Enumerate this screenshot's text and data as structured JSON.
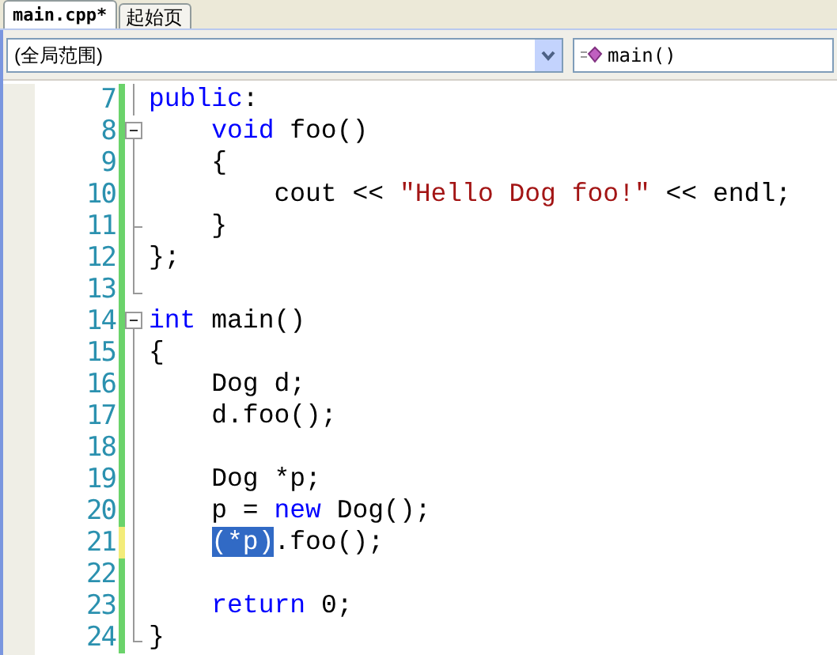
{
  "tabs": [
    {
      "label": "main.cpp*",
      "selected": true
    },
    {
      "label": "起始页",
      "selected": false
    }
  ],
  "scope_dropdown": {
    "value": "(全局范围)"
  },
  "member_dropdown": {
    "value": "main()"
  },
  "lines": [
    {
      "number": "7",
      "modified": false,
      "kind": "line",
      "tokens": [
        {
          "kind": "keyword",
          "text": "public"
        },
        {
          "kind": "plain",
          "text": ":"
        }
      ]
    },
    {
      "number": "8",
      "modified": false,
      "kind": "box",
      "tokens": [
        {
          "kind": "keyword",
          "text": "    void"
        },
        {
          "kind": "plain",
          "text": " foo()"
        }
      ]
    },
    {
      "number": "9",
      "modified": false,
      "kind": "line",
      "tokens": [
        {
          "kind": "plain",
          "text": "    {"
        }
      ]
    },
    {
      "number": "10",
      "modified": false,
      "kind": "line",
      "tokens": [
        {
          "kind": "plain",
          "text": "        cout << "
        },
        {
          "kind": "string",
          "text": "\"Hello Dog foo!\""
        },
        {
          "kind": "plain",
          "text": " << endl;"
        }
      ]
    },
    {
      "number": "11",
      "modified": false,
      "kind": "tick",
      "tokens": [
        {
          "kind": "plain",
          "text": "    }"
        }
      ]
    },
    {
      "number": "12",
      "modified": false,
      "kind": "line",
      "tokens": [
        {
          "kind": "plain",
          "text": "};"
        }
      ]
    },
    {
      "number": "13",
      "modified": false,
      "kind": "end"
    },
    {
      "number": "14",
      "modified": false,
      "kind": "box",
      "tokens": [
        {
          "kind": "keyword",
          "text": "int"
        },
        {
          "kind": "plain",
          "text": " main()"
        }
      ]
    },
    {
      "number": "15",
      "modified": false,
      "kind": "line",
      "tokens": [
        {
          "kind": "plain",
          "text": "{"
        }
      ]
    },
    {
      "number": "16",
      "modified": false,
      "kind": "line",
      "tokens": [
        {
          "kind": "plain",
          "text": "    Dog d;"
        }
      ]
    },
    {
      "number": "17",
      "modified": false,
      "kind": "line",
      "tokens": [
        {
          "kind": "plain",
          "text": "    d.foo();"
        }
      ]
    },
    {
      "number": "18",
      "modified": false,
      "kind": "line"
    },
    {
      "number": "19",
      "modified": false,
      "kind": "line",
      "tokens": [
        {
          "kind": "plain",
          "text": "    Dog *p;"
        }
      ]
    },
    {
      "number": "20",
      "modified": false,
      "kind": "line",
      "tokens": [
        {
          "kind": "plain",
          "text": "    p = "
        },
        {
          "kind": "keyword",
          "text": "new"
        },
        {
          "kind": "plain",
          "text": " Dog();"
        }
      ]
    },
    {
      "number": "21",
      "modified": true,
      "kind": "line",
      "tokens": [
        {
          "kind": "selected",
          "text": "    (*p)"
        },
        {
          "kind": "plain",
          "text": ".foo();"
        }
      ]
    },
    {
      "number": "22",
      "modified": false,
      "kind": "line"
    },
    {
      "number": "23",
      "modified": false,
      "kind": "line",
      "tokens": [
        {
          "kind": "keyword",
          "text": "    return"
        },
        {
          "kind": "plain",
          "text": " 0;"
        }
      ]
    },
    {
      "number": "24",
      "modified": false,
      "kind": "end",
      "tokens": [
        {
          "kind": "plain",
          "text": "}"
        }
      ]
    }
  ]
}
